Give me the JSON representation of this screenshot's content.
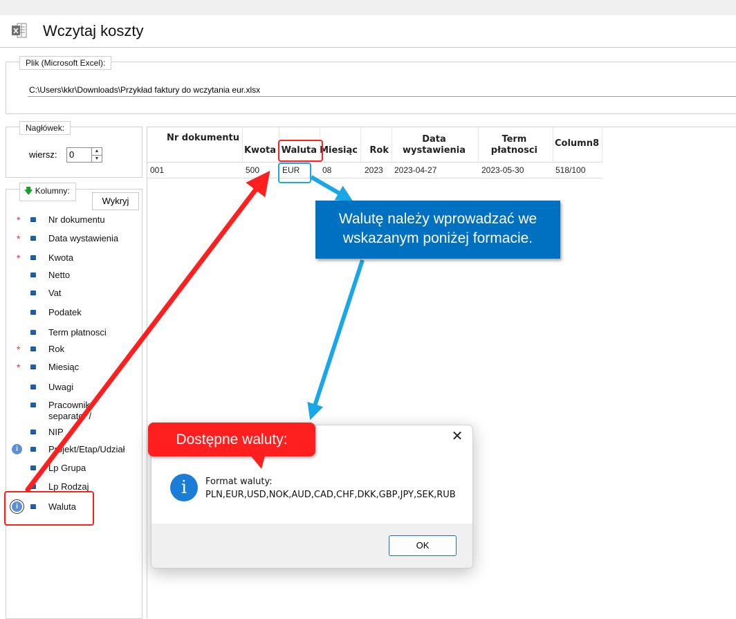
{
  "window": {
    "title": "Wczytaj koszty"
  },
  "file": {
    "legend": "Plik (Microsoft Excel):",
    "path": "C:\\Users\\kkr\\Downloads\\Przykład faktury do wczytania eur.xlsx"
  },
  "header": {
    "legend": "Nagłówek:",
    "row_label": "wiersz:",
    "row_value": "0"
  },
  "columns": {
    "legend": "Kolumny:",
    "detect_button": "Wykryj",
    "items": [
      {
        "label": "Nr dokumentu",
        "required": true,
        "info": false
      },
      {
        "label": "Data wystawienia",
        "required": true,
        "info": false
      },
      {
        "label": "Kwota",
        "required": true,
        "info": false
      },
      {
        "label": "Netto",
        "required": false,
        "info": false
      },
      {
        "label": "Vat",
        "required": false,
        "info": false
      },
      {
        "label": "Podatek",
        "required": false,
        "info": false
      },
      {
        "label": "Term płatnosci",
        "required": false,
        "info": false
      },
      {
        "label": "Rok",
        "required": true,
        "info": false
      },
      {
        "label": "Miesiąc",
        "required": true,
        "info": false
      },
      {
        "label": "Uwagi",
        "required": false,
        "info": false
      },
      {
        "label": "Pracownik:\nseparator /",
        "required": false,
        "info": false
      },
      {
        "label": "NIP",
        "required": false,
        "info": false
      },
      {
        "label": "Projekt/Etap/Udział",
        "required": false,
        "info": true
      },
      {
        "label": "Lp Grupa",
        "required": false,
        "info": false
      },
      {
        "label": "Lp Rodzaj",
        "required": false,
        "info": false
      },
      {
        "label": "Waluta",
        "required": false,
        "info": true
      }
    ],
    "required_mark": "*",
    "info_mark": "i"
  },
  "grid": {
    "headers": [
      "Nr dokumentu",
      "Kwota",
      "Waluta",
      "Miesiąc",
      "Rok",
      "Data\nwystawienia",
      "Term\npłatnosci",
      "Column8"
    ],
    "rows": [
      [
        "001",
        "500",
        "EUR",
        "08",
        "2023",
        "2023-04-27",
        "2023-05-30",
        "518/100"
      ]
    ]
  },
  "callouts": {
    "blue": "Walutę należy wprowadzać we wskazanym poniżej formacie.",
    "red": "Dostępne waluty:"
  },
  "dialog": {
    "close": "✕",
    "icon_glyph": "i",
    "message_title": "Format waluty:",
    "message_body": "PLN,EUR,USD,NOK,AUD,CAD,CHF,DKK,GBP,JPY,SEK,RUB",
    "ok_label": "OK"
  },
  "colors": {
    "annotation_red": "#ff1f1f",
    "annotation_blue": "#0070c0",
    "arrow_cyan": "#1aa7e8",
    "bullet_blue": "#1f5fa8"
  }
}
